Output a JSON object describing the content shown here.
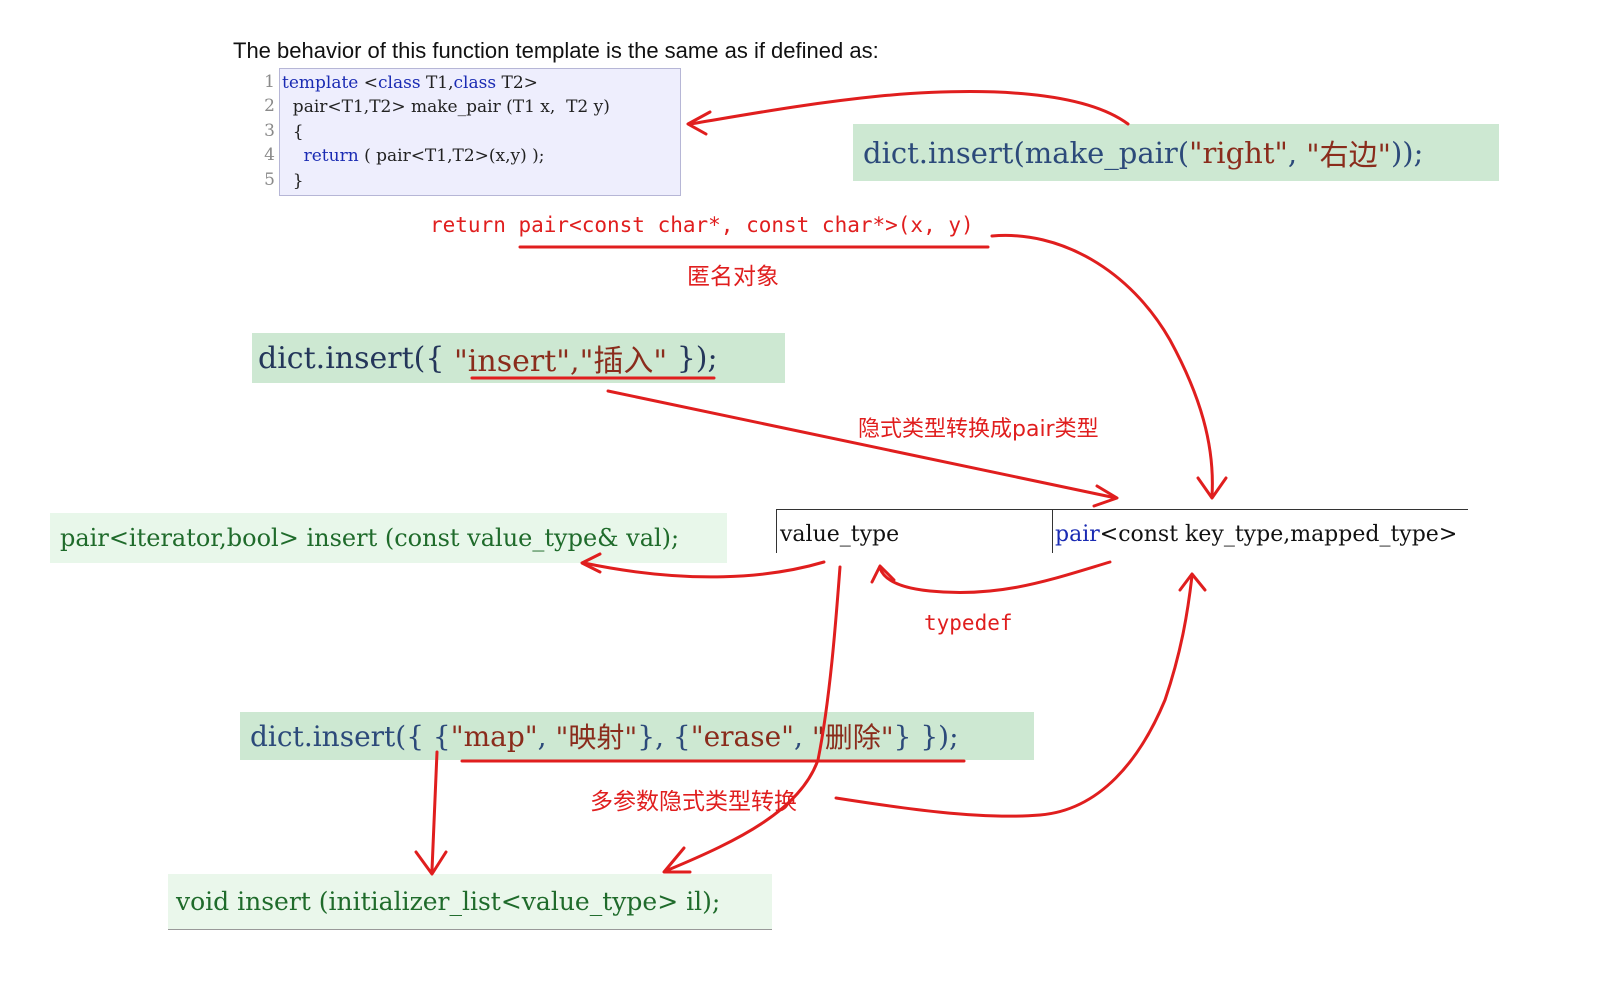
{
  "heading": "The behavior of this function template is the same as if defined as:",
  "listing": {
    "line_numbers": [
      "1",
      "2",
      "3",
      "4",
      "5"
    ],
    "lines": [
      {
        "kw": "template",
        "rest": " <",
        "kw2": "class",
        "rest2": " T1,",
        "kw3": "class",
        "rest3": " T2>"
      },
      {
        "text": "  pair<T1,T2> make_pair (T1 x,  T2 y)"
      },
      {
        "text": "  {"
      },
      {
        "indent": "    ",
        "kw": "return",
        "rest": " ( pair<T1,T2>(x,y) );"
      },
      {
        "text": "  }"
      }
    ]
  },
  "code_right": {
    "prefix": "dict.insert(make_pair(",
    "arg1": "\"right\"",
    "sep": ", ",
    "arg2": "\"右边\"",
    "suffix": "));"
  },
  "return_line": "return pair<const char*, const char*>(x, y)",
  "anonymous_label": "匿名对象",
  "code_mid": {
    "prefix": "dict.insert({ ",
    "arg": "\"insert\",\"插入\"",
    "suffix": " });"
  },
  "implicit_label": "隐式类型转换成pair类型",
  "pair_insert": "pair<iterator,bool> insert (const value_type& val);",
  "table": {
    "left": "value_type",
    "right_kw": "pair",
    "right_rest": "<const key_type,mapped_type>"
  },
  "typedef_label": "typedef",
  "code_bottom": {
    "prefix": "dict.insert({ {",
    "a1": "\"map\"",
    "s1": ", ",
    "a2": "\"映射\"",
    "s2": "}, {",
    "a3": "\"erase\"",
    "s3": ", ",
    "a4": "\"删除\"",
    "suffix": "} });"
  },
  "multi_label": "多参数隐式类型转换",
  "void_insert": "void insert (initializer_list<value_type> il);",
  "colors": {
    "annotation_red": "#e01e1e",
    "strip_green": "#cde8d2",
    "listing_bg": "#eeeefd",
    "keyword_blue": "#1a2bb3"
  }
}
